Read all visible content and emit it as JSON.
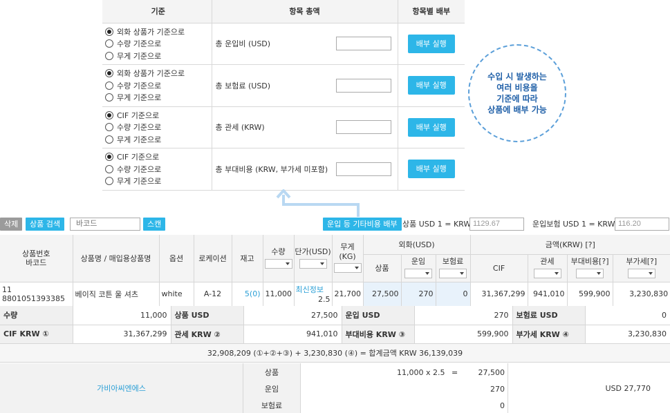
{
  "alloc": {
    "headers": [
      "기준",
      "항목 총액",
      "항목별 배부"
    ],
    "rows": [
      {
        "options": [
          "외화 상품가 기준으로",
          "수량 기준으로",
          "무게 기준으로"
        ],
        "selected": 0,
        "item": "총 운입비 (USD)",
        "button": "배부 실행"
      },
      {
        "options": [
          "외화 상품가 기준으로",
          "수량 기준으로",
          "무게 기준으로"
        ],
        "selected": 0,
        "item": "총 보험료 (USD)",
        "button": "배부 실행"
      },
      {
        "options": [
          "CIF 기준으로",
          "수량 기준으로",
          "무게 기준으로"
        ],
        "selected": 0,
        "item": "총 관세 (KRW)",
        "button": "배부 실행"
      },
      {
        "options": [
          "CIF 기준으로",
          "수량 기준으로",
          "무게 기준으로"
        ],
        "selected": 0,
        "item": "총 부대비용 (KRW, 부가세 미포함)",
        "button": "배부 실행"
      }
    ]
  },
  "callout": {
    "lines": [
      "수입 시 발생하는",
      "여러 비용을",
      "기준에 따라",
      "상품에 배부 가능"
    ]
  },
  "toolbar": {
    "delete": "삭제",
    "product_search": "상품 검색",
    "barcode_placeholder": "바코드",
    "scan": "스캔",
    "other_cost": "운입 등 기타비용 배부",
    "fx_label": "상품 USD 1 = KRW",
    "fx_value": "1129.67",
    "ins_label": "운입보험 USD 1 = KRW",
    "ins_value": "116.20"
  },
  "grid": {
    "headers": {
      "code": "상품번호\n바코드",
      "name": "상품명 / 매입용상품명",
      "option": "옵션",
      "location": "로케이션",
      "stock": "재고",
      "qty": "수량",
      "unit_price": "단가(USD)",
      "weight": "무게(KG)",
      "fx_group": "외화(USD)",
      "fx_product": "상품",
      "fx_freight": "운임",
      "fx_insurance": "보험료",
      "krw_group": "금액(KRW) [?]",
      "cif": "CIF",
      "duty": "관세",
      "extra": "부대비용[?]",
      "vat": "부가세[?]"
    },
    "row": {
      "code": "11",
      "barcode": "8801051393385",
      "name": "베이직 코튼 울 셔츠",
      "option": "white",
      "location": "A-12",
      "stock": "5(0)",
      "qty": "11,000",
      "unit_price_link": "최신정보",
      "unit_price": "2.5",
      "weight": "21,700",
      "fx_product": "27,500",
      "fx_freight": "270",
      "fx_insurance": "0",
      "cif": "31,367,299",
      "duty": "941,010",
      "extra": "599,900",
      "vat": "3,230,830"
    }
  },
  "summary": {
    "row1": [
      {
        "label": "수량",
        "value": "11,000"
      },
      {
        "label": "상품 USD",
        "value": "27,500"
      },
      {
        "label": "운입 USD",
        "value": "270"
      },
      {
        "label": "보험료 USD",
        "value": "0"
      }
    ],
    "row2": [
      {
        "label": "CIF KRW ①",
        "value": "31,367,299"
      },
      {
        "label": "관세 KRW ②",
        "value": "941,010"
      },
      {
        "label": "부대비용 KRW ③",
        "value": "599,900"
      },
      {
        "label": "부가세 KRW ④",
        "value": "3,230,830"
      }
    ],
    "formula": "32,908,209 (①+②+③) + 3,230,830 (④) = 합계금액 KRW   36,139,039"
  },
  "bottom": {
    "supplier": "가비아씨엔에스",
    "labels": [
      "상품",
      "운임",
      "보험료"
    ],
    "calc": [
      {
        "expr": "11,000 x 2.5",
        "eq": "=",
        "value": "27,500"
      },
      {
        "expr": "",
        "eq": "",
        "value": "270"
      },
      {
        "expr": "",
        "eq": "",
        "value": "0"
      }
    ],
    "total": "USD   27,770"
  }
}
